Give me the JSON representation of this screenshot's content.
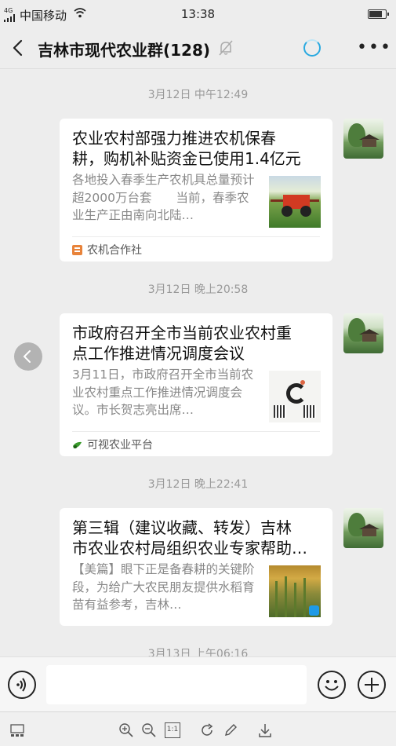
{
  "status_bar": {
    "signal": "4G",
    "carrier": "中国移动",
    "time": "13:38",
    "battery_level": 0.85
  },
  "header": {
    "title": "吉林市现代农业群(128)"
  },
  "messages": [
    {
      "timestamp": "3月12日 中午12:49",
      "title_line1": "农业农村部强力推进农机保春",
      "title_line2": "耕，购机补贴资金已使用1.4亿元",
      "desc": "各地投入春季生产农机具总量预计超2000万台套　　当前，春季农业生产正由南向北陆…",
      "source": "农机合作社"
    },
    {
      "timestamp": "3月12日 晚上20:58",
      "title_line1": "市政府召开全市当前农业农村重",
      "title_line2": "点工作推进情况调度会议",
      "desc": "3月11日，市政府召开全市当前农业农村重点工作推进情况调度会议。市长贺志亮出席…",
      "source": "可视农业平台"
    },
    {
      "timestamp": "3月12日 晚上22:41",
      "title_line1": "第三辑（建议收藏、转发）吉林",
      "title_line2": "市农业农村局组织农业专家帮助…",
      "desc": "【美篇】眼下正是备春耕的关键阶段，为给广大农民朋友提供水稻育苗有益参考，吉林…",
      "source": ""
    }
  ],
  "partial_timestamp": "3月13日 上午06:16",
  "input": {
    "value": "",
    "placeholder": ""
  },
  "viewer_toolbar": {
    "actual_size_label": "1:1"
  },
  "colors": {
    "background": "#ededed",
    "accent_loading": "#29a9e0",
    "card": "#ffffff"
  }
}
